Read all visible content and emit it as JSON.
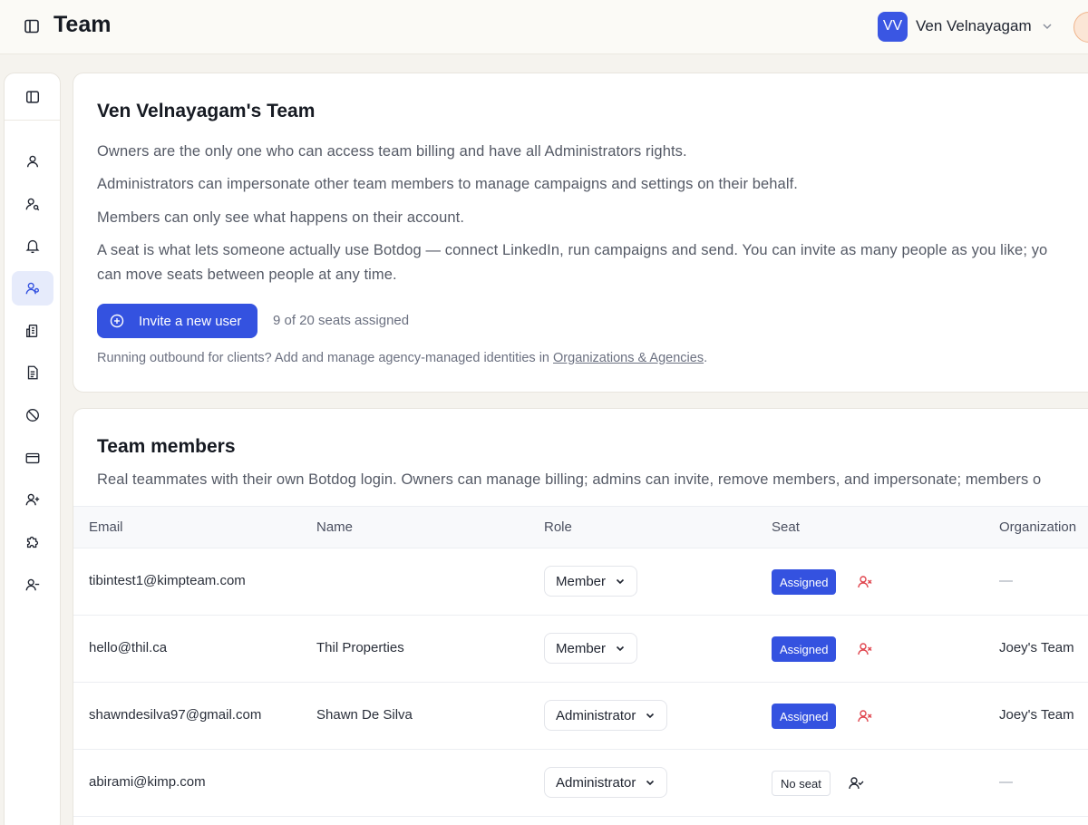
{
  "header": {
    "title": "Team",
    "user": {
      "initials": "VV",
      "name": "Ven Velnayagam"
    }
  },
  "team_card": {
    "title": "Ven Velnayagam's Team",
    "lines": [
      "Owners are the only one who can access team billing and have all Administrators rights.",
      "Administrators can impersonate other team members to manage campaigns and settings on their behalf.",
      "Members can only see what happens on their account.",
      "A seat is what lets someone actually use Botdog — connect LinkedIn, run campaigns and send. You can invite as many people as you like; yo",
      "can move seats between people at any time."
    ],
    "invite_label": "Invite a new user",
    "seats_text": "9 of 20 seats assigned",
    "agency_prefix": "Running outbound for clients? Add and manage agency-managed identities in ",
    "agency_link": "Organizations & Agencies",
    "agency_suffix": "."
  },
  "members": {
    "title": "Team members",
    "description": "Real teammates with their own Botdog login. Owners can manage billing; admins can invite, remove members, and impersonate; members o",
    "columns": {
      "email": "Email",
      "name": "Name",
      "role": "Role",
      "seat": "Seat",
      "org": "Organization"
    },
    "rows": [
      {
        "email": "tibintest1@kimpteam.com",
        "name": "",
        "role": "Member",
        "seat": "Assigned",
        "org": "—"
      },
      {
        "email": "hello@thil.ca",
        "name": "Thil Properties",
        "role": "Member",
        "seat": "Assigned",
        "org": "Joey's Team"
      },
      {
        "email": "shawndesilva97@gmail.com",
        "name": "Shawn De Silva",
        "role": "Administrator",
        "seat": "Assigned",
        "org": "Joey's Team"
      },
      {
        "email": "abirami@kimp.com",
        "name": "",
        "role": "Administrator",
        "seat": "No seat",
        "org": "—"
      }
    ]
  },
  "colors": {
    "accent": "#3452e0",
    "danger": "#e0454e",
    "active_nav": "#e6ebfb"
  }
}
